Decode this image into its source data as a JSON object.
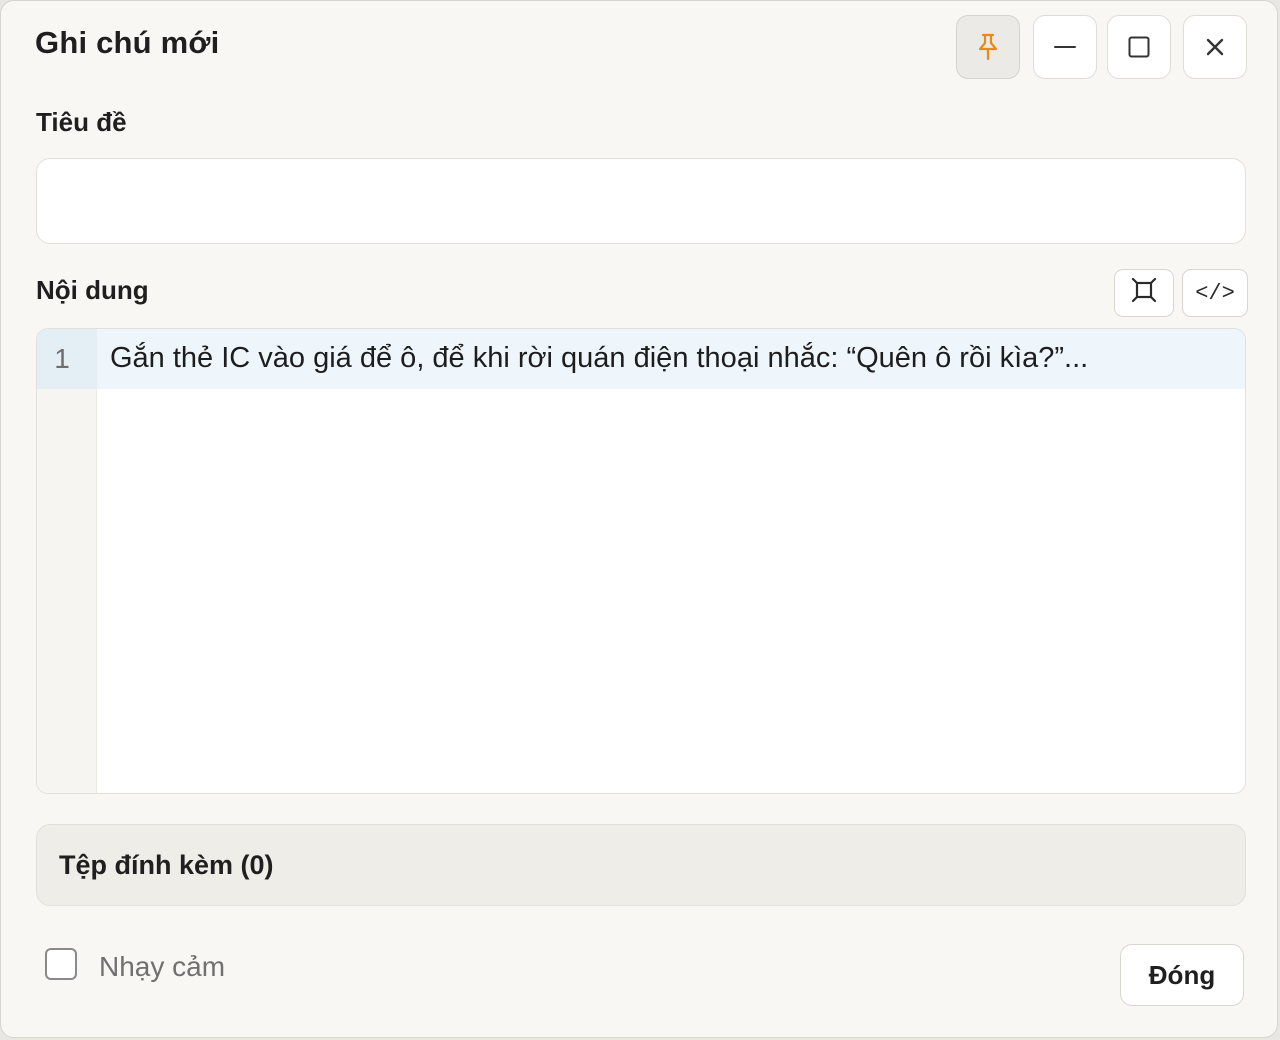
{
  "window": {
    "title": "Ghi chú mới"
  },
  "controls": {
    "pin_icon": "pin-icon",
    "minimize_icon": "minimize-icon",
    "maximize_icon": "maximize-icon",
    "close_icon": "close-icon",
    "accent_color": "#e88a1a"
  },
  "form": {
    "title_label": "Tiêu đề",
    "title_value": "",
    "content_label": "Nội dung",
    "expand_icon": "expand-icon",
    "code_toggle_label": "</>"
  },
  "editor": {
    "lines": [
      {
        "number": "1",
        "text": "Gắn thẻ IC vào giá để ô, để khi rời quán điện thoại nhắc: “Quên ô rồi kìa?”..."
      }
    ]
  },
  "attachments": {
    "label": "Tệp đính kèm (0)"
  },
  "footer": {
    "sensitive_label": "Nhạy cảm",
    "sensitive_checked": false,
    "close_label": "Đóng"
  }
}
